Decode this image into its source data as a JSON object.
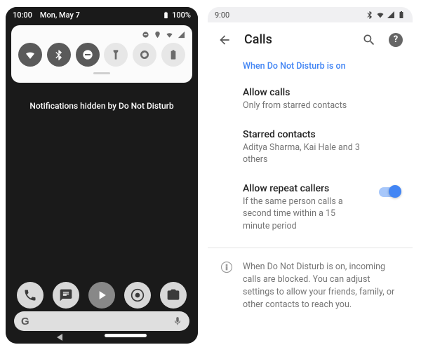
{
  "left": {
    "status": {
      "time": "10:00",
      "date": "Mon, May 7",
      "battery": "100%"
    },
    "dnd_message": "Notifications hidden by Do Not Disturb",
    "search_logo": "G"
  },
  "right": {
    "status": {
      "time": "9:00"
    },
    "header": {
      "title": "Calls"
    },
    "section_header": "When Do Not Disturb is on",
    "allow_calls": {
      "title": "Allow calls",
      "subtitle": "Only from starred contacts"
    },
    "starred": {
      "title": "Starred contacts",
      "subtitle": "Aditya Sharma, Kai Hale and 3 others"
    },
    "repeat": {
      "title": "Allow repeat callers",
      "subtitle": "If the same person calls a second time within a 15 minute period"
    },
    "info": "When Do Not Disturb is on, incoming calls are blocked. You can adjust settings to allow your friends, family, or other contacts to reach you."
  }
}
